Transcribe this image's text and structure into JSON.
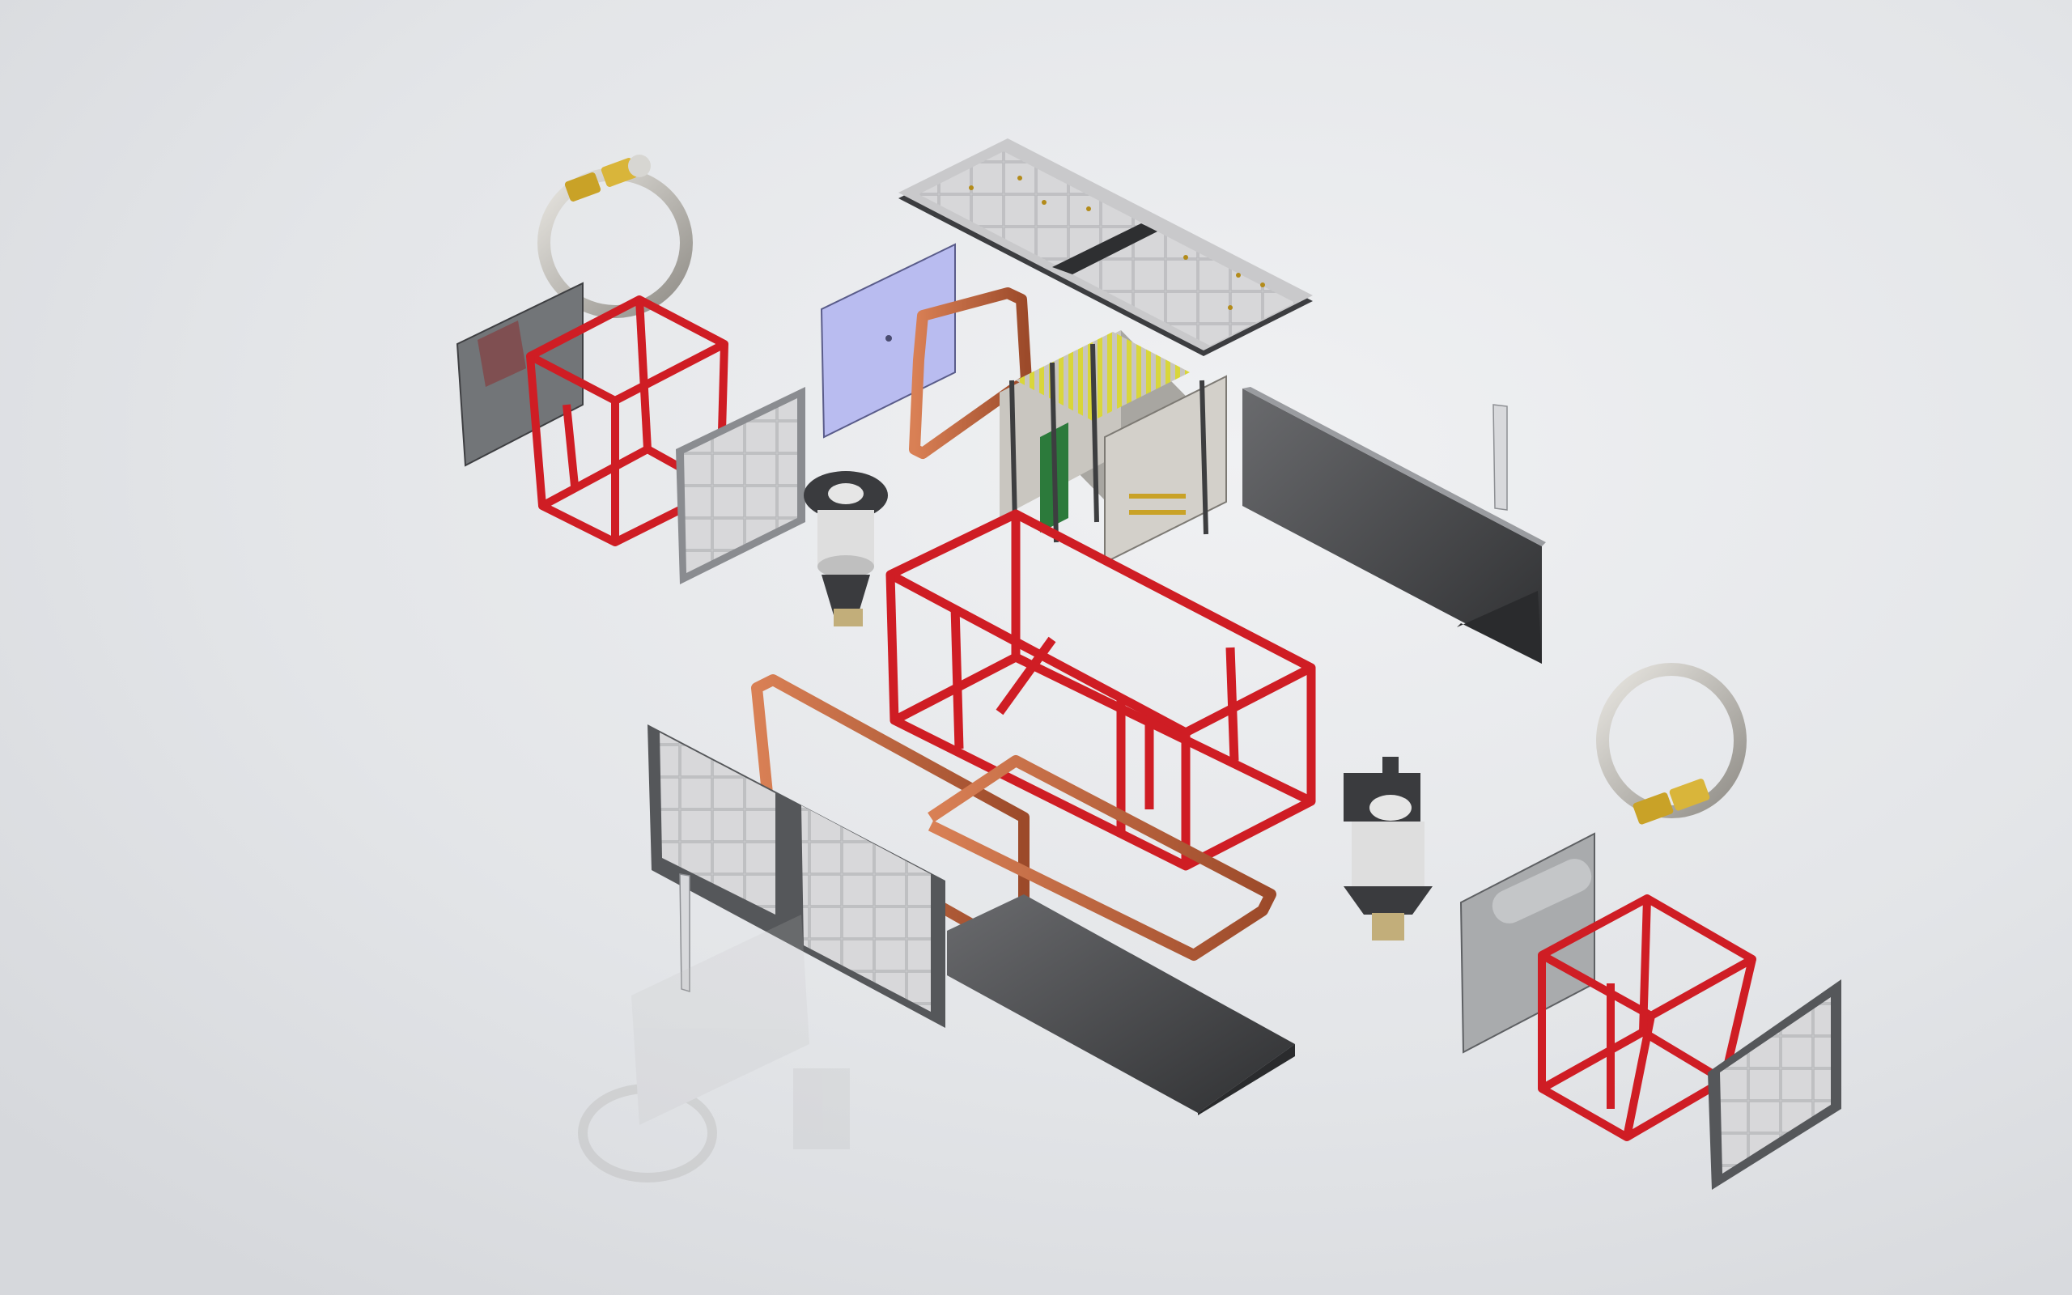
{
  "scene": {
    "kind": "exploded-assembly-render",
    "background_color": "#e6e8eb",
    "parts": [
      {
        "name": "solar-panel-top",
        "color": "#d9d6cf"
      },
      {
        "name": "magnetometer-panel",
        "color": "#b9bcf0"
      },
      {
        "name": "magnetorquer-coil-upper",
        "color": "#c06a45"
      },
      {
        "name": "avionics-stack",
        "color": "#c9c6c0"
      },
      {
        "name": "side-plate-right",
        "color": "#4a4b4d"
      },
      {
        "name": "slot-plate-right",
        "color": "#d8d9dc"
      },
      {
        "name": "frame-main",
        "color": "#cf1d24"
      },
      {
        "name": "reaction-wheel-upper",
        "color": "#3a3b3e"
      },
      {
        "name": "solar-panel-left",
        "color": "#d8d8da"
      },
      {
        "name": "frame-left",
        "color": "#cf1d24"
      },
      {
        "name": "back-plate-left",
        "color": "#727578"
      },
      {
        "name": "ring-antenna-left",
        "color": "#bfbcb6"
      },
      {
        "name": "magnetorquer-coil-lower",
        "color": "#c06a45"
      },
      {
        "name": "solar-panel-bottom",
        "color": "#d8d8da"
      },
      {
        "name": "bottom-plate",
        "color": "#4a4b4d"
      },
      {
        "name": "reaction-wheel-lower",
        "color": "#3a3b3e"
      },
      {
        "name": "frame-right",
        "color": "#cf1d24"
      },
      {
        "name": "cylinder-plate-right",
        "color": "#a9abad"
      },
      {
        "name": "solar-panel-right",
        "color": "#d8d8da"
      },
      {
        "name": "ring-antenna-right",
        "color": "#bfbcb6"
      },
      {
        "name": "connector-gold",
        "color": "#c9a227"
      }
    ]
  }
}
